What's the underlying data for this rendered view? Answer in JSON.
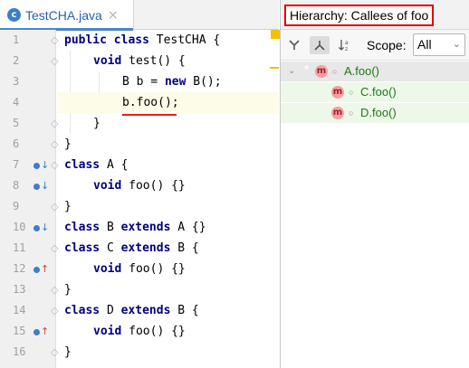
{
  "editor": {
    "tab": {
      "icon_letter": "c",
      "title": "TestCHA.java",
      "close": "×"
    },
    "lines": [
      {
        "num": "1",
        "marker": ""
      },
      {
        "num": "2",
        "marker": ""
      },
      {
        "num": "3",
        "marker": ""
      },
      {
        "num": "4",
        "marker": ""
      },
      {
        "num": "5",
        "marker": ""
      },
      {
        "num": "6",
        "marker": ""
      },
      {
        "num": "7",
        "marker": "down"
      },
      {
        "num": "8",
        "marker": "down"
      },
      {
        "num": "9",
        "marker": ""
      },
      {
        "num": "10",
        "marker": "down"
      },
      {
        "num": "11",
        "marker": ""
      },
      {
        "num": "12",
        "marker": "up"
      },
      {
        "num": "13",
        "marker": ""
      },
      {
        "num": "14",
        "marker": ""
      },
      {
        "num": "15",
        "marker": "up"
      },
      {
        "num": "16",
        "marker": ""
      }
    ],
    "code": {
      "l1_kw": "public class",
      "l1_rest": " TestCHA {",
      "l2_kw": "void",
      "l2_rest": " test() {",
      "l3_pre": "B b = ",
      "l3_kw": "new",
      "l3_rest": " B();",
      "l4": "b.foo();",
      "l5": "}",
      "l6": "}",
      "l7_kw": "class",
      "l7_rest": " A {",
      "l8_kw": "void",
      "l8_rest": " foo() {}",
      "l9": "}",
      "l10_kw1": "class",
      "l10_mid": " B ",
      "l10_kw2": "extends",
      "l10_rest": " A {}",
      "l11_kw1": "class",
      "l11_mid": " C ",
      "l11_kw2": "extends",
      "l11_rest": " B {",
      "l12_kw": "void",
      "l12_rest": " foo() {}",
      "l13": "}",
      "l14_kw1": "class",
      "l14_mid": " D ",
      "l14_kw2": "extends",
      "l14_rest": " B {",
      "l15_kw": "void",
      "l15_rest": " foo() {}",
      "l16": "}"
    }
  },
  "hierarchy": {
    "title": "Hierarchy:  Callees of foo",
    "scope_label": "Scope:",
    "scope_value": "All",
    "toolbar_icons": [
      "caller-hierarchy-icon",
      "callee-hierarchy-icon",
      "sort-alpha-icon"
    ],
    "tree": [
      {
        "icon_letter": "m",
        "label": "A.foo()",
        "params": "()"
      },
      {
        "icon_letter": "m",
        "label": "C.foo()",
        "params": "()"
      },
      {
        "icon_letter": "m",
        "label": "D.foo()",
        "params": "()"
      }
    ],
    "colors": {
      "callee_text": "#1a7a1a",
      "method_icon": "#f5a0a0",
      "highlight_border": "#e00000"
    }
  }
}
